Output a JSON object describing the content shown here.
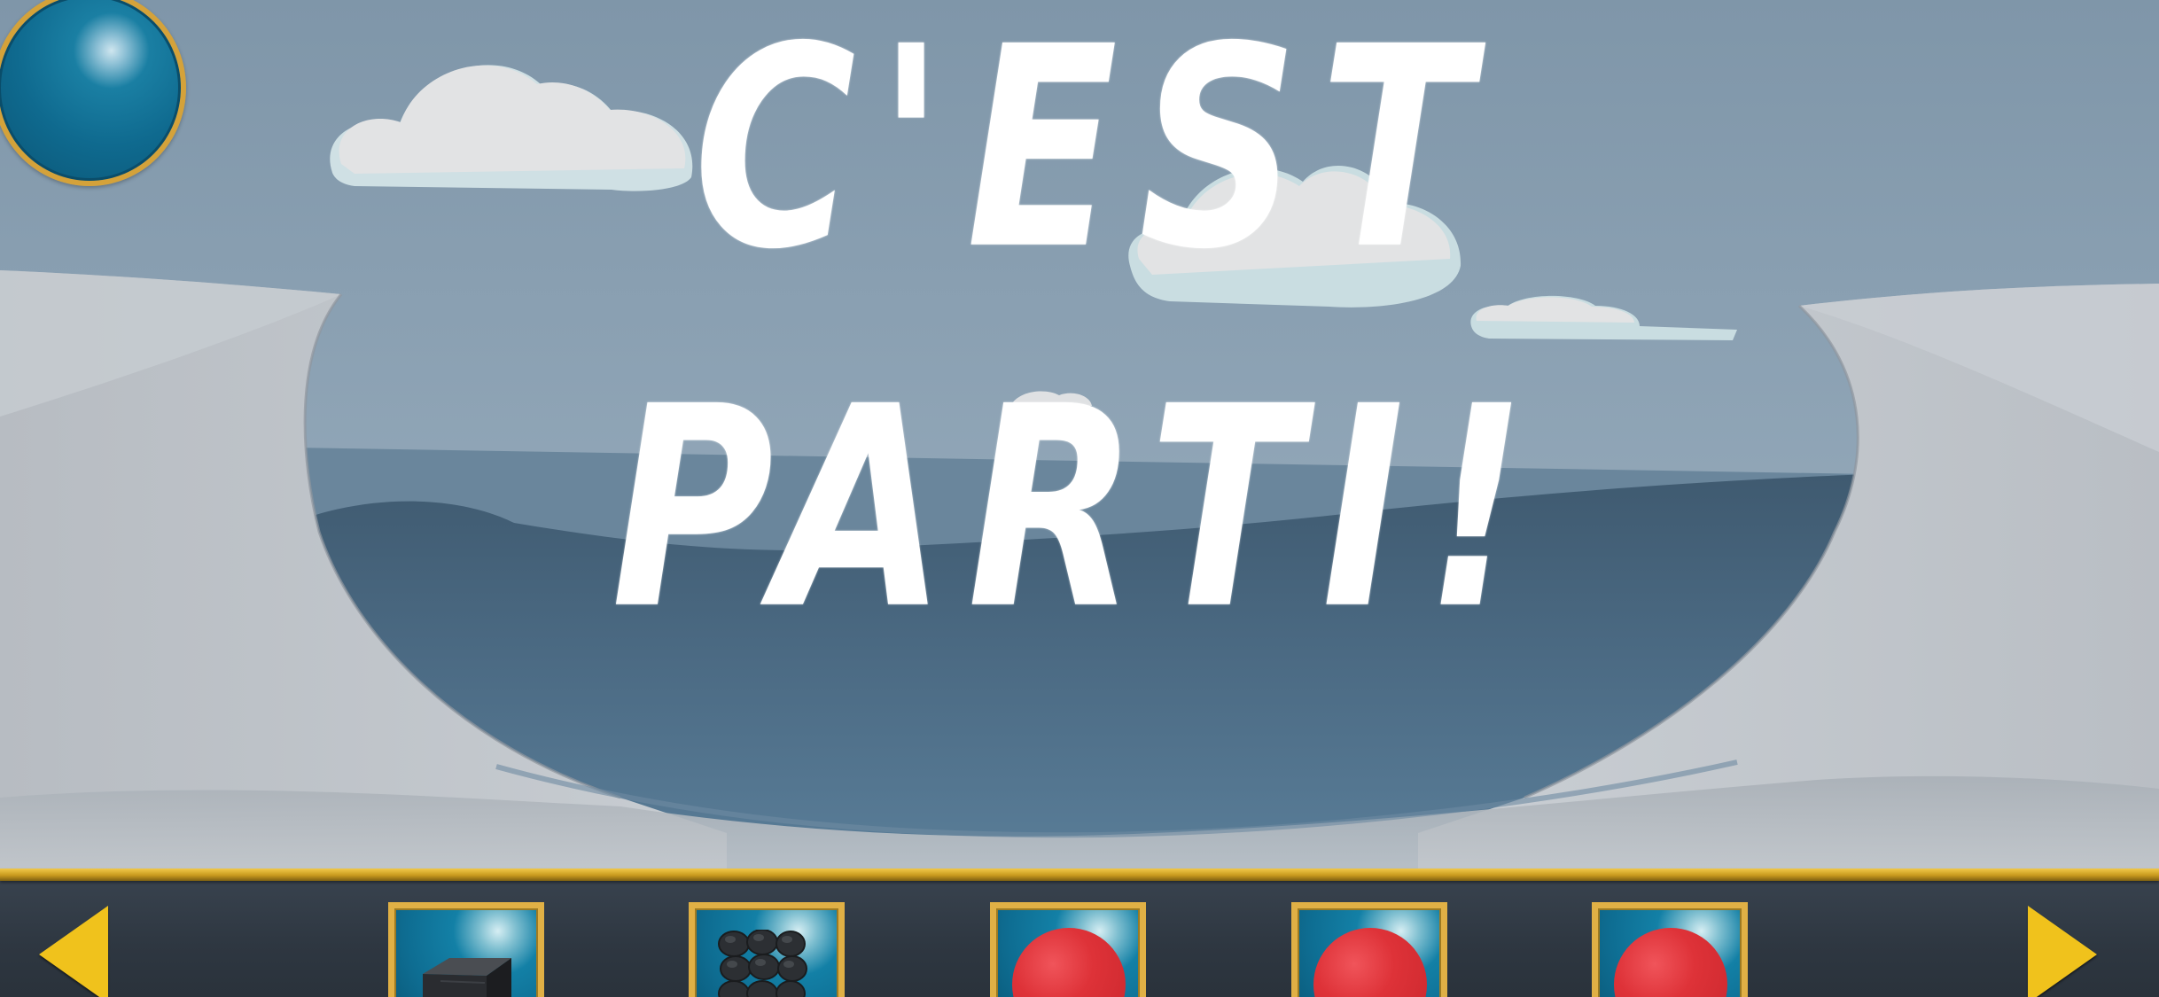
{
  "title": {
    "line1": "C'EST",
    "line2": "PARTI!"
  },
  "colors": {
    "sky": "#8aa0b3",
    "title_text": "#ffffff",
    "toolbar_rail_gold": "#d4a23a",
    "toolbar_bg": "#2e3741",
    "arrow_yellow": "#f0c21c",
    "item_ball_red": "#de3238",
    "slot_frame_gold": "#e0b045",
    "slot_bg_blue": "#0e6d92"
  },
  "hud": {
    "pause_button_icon": "blue-orb-icon"
  },
  "toolbar": {
    "left_arrow_icon": "triangle-left-icon",
    "right_arrow_icon": "triangle-right-icon",
    "items": [
      {
        "icon": "black-cube-icon"
      },
      {
        "icon": "coal-rocks-icon"
      },
      {
        "icon": "red-ball-icon"
      },
      {
        "icon": "red-ball-icon"
      },
      {
        "icon": "red-ball-icon"
      }
    ]
  }
}
